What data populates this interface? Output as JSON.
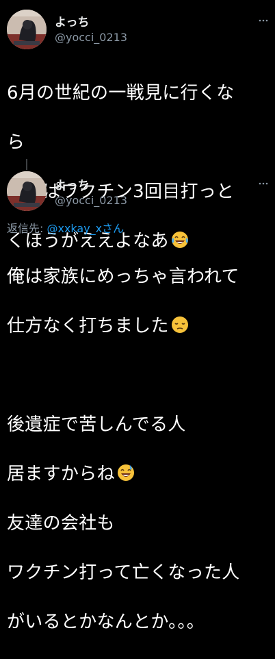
{
  "tweet1": {
    "display_name": "よっち",
    "handle": "@yocci_0213",
    "text_lines": [
      "6月の世紀の一戦見に行くな",
      "ら",
      "やっぱワクチン3回目打っと",
      "くほうがええよなあ"
    ],
    "end_emoji": "laughing-tears-emoji"
  },
  "tweet2": {
    "display_name": "よっち",
    "handle": "@yocci_0213",
    "reply_prefix": "返信先: ",
    "reply_mention": "@xxkay_xさん",
    "text_lines": [
      "俺は家族にめっちゃ言われて",
      "仕方なく打ちました",
      "",
      "後遺症で苦しんでる人",
      "居ますからね",
      "友達の会社も",
      "ワクチン打って亡くなった人",
      "がいるとかなんとか。。。"
    ]
  },
  "colors": {
    "background": "#000000",
    "text": "#ffffff",
    "secondary": "#8b98a5",
    "accent": "#1d9bf0"
  }
}
